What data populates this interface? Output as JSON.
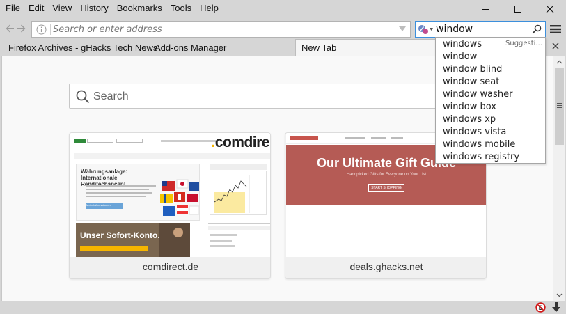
{
  "menu": {
    "items": [
      {
        "underline": "F",
        "rest": "ile"
      },
      {
        "underline": "E",
        "rest": "dit"
      },
      {
        "underline": "V",
        "rest": "iew"
      },
      {
        "underline": "",
        "pre": "Hi",
        "u2": "s",
        "rest": "tory"
      },
      {
        "underline": "B",
        "rest": "ookmarks"
      },
      {
        "underline": "T",
        "rest": "ools"
      },
      {
        "underline": "H",
        "rest": "elp"
      }
    ],
    "labels": [
      "File",
      "Edit",
      "View",
      "History",
      "Bookmarks",
      "Tools",
      "Help"
    ]
  },
  "window_controls": {
    "minimize": "minimize-icon",
    "maximize": "maximize-icon",
    "close": "close-icon"
  },
  "navbar": {
    "url_placeholder": "Search or enter address",
    "search_value": "window"
  },
  "bookmarks": [
    "Firefox Archives - gHacks Tech News",
    "Add-ons Manager"
  ],
  "tab": {
    "label": "New Tab"
  },
  "newtab": {
    "search_placeholder": "Search",
    "tiles": [
      {
        "title": "comdirect.de"
      },
      {
        "title": "deals.ghacks.net"
      }
    ]
  },
  "thumbs": {
    "comdirect": {
      "logo_dot": ".",
      "logo": "comdire",
      "banner_heading": "Währungsanlage: Internationale Renditechancen!",
      "banner_button": "Mehr Informationen",
      "sofort": "Unser Sofort-Konto."
    },
    "deals": {
      "hero": "Our Ultimate Gift Guide",
      "hero_sub": "Handpicked Gifts for Everyone on Your List",
      "hero_button": "START SHOPPING"
    }
  },
  "suggestions": {
    "header": "Suggesti...",
    "items": [
      "windows",
      "window",
      "window blind",
      "window seat",
      "window washer",
      "window box",
      "windows xp",
      "windows vista",
      "windows mobile",
      "windows registry"
    ]
  },
  "colors": {
    "chrome": "#d6d6d6",
    "search_focus": "#3c8fdc",
    "deals_hero": "#b55b55",
    "comdirect_yellow": "#f6b500"
  }
}
